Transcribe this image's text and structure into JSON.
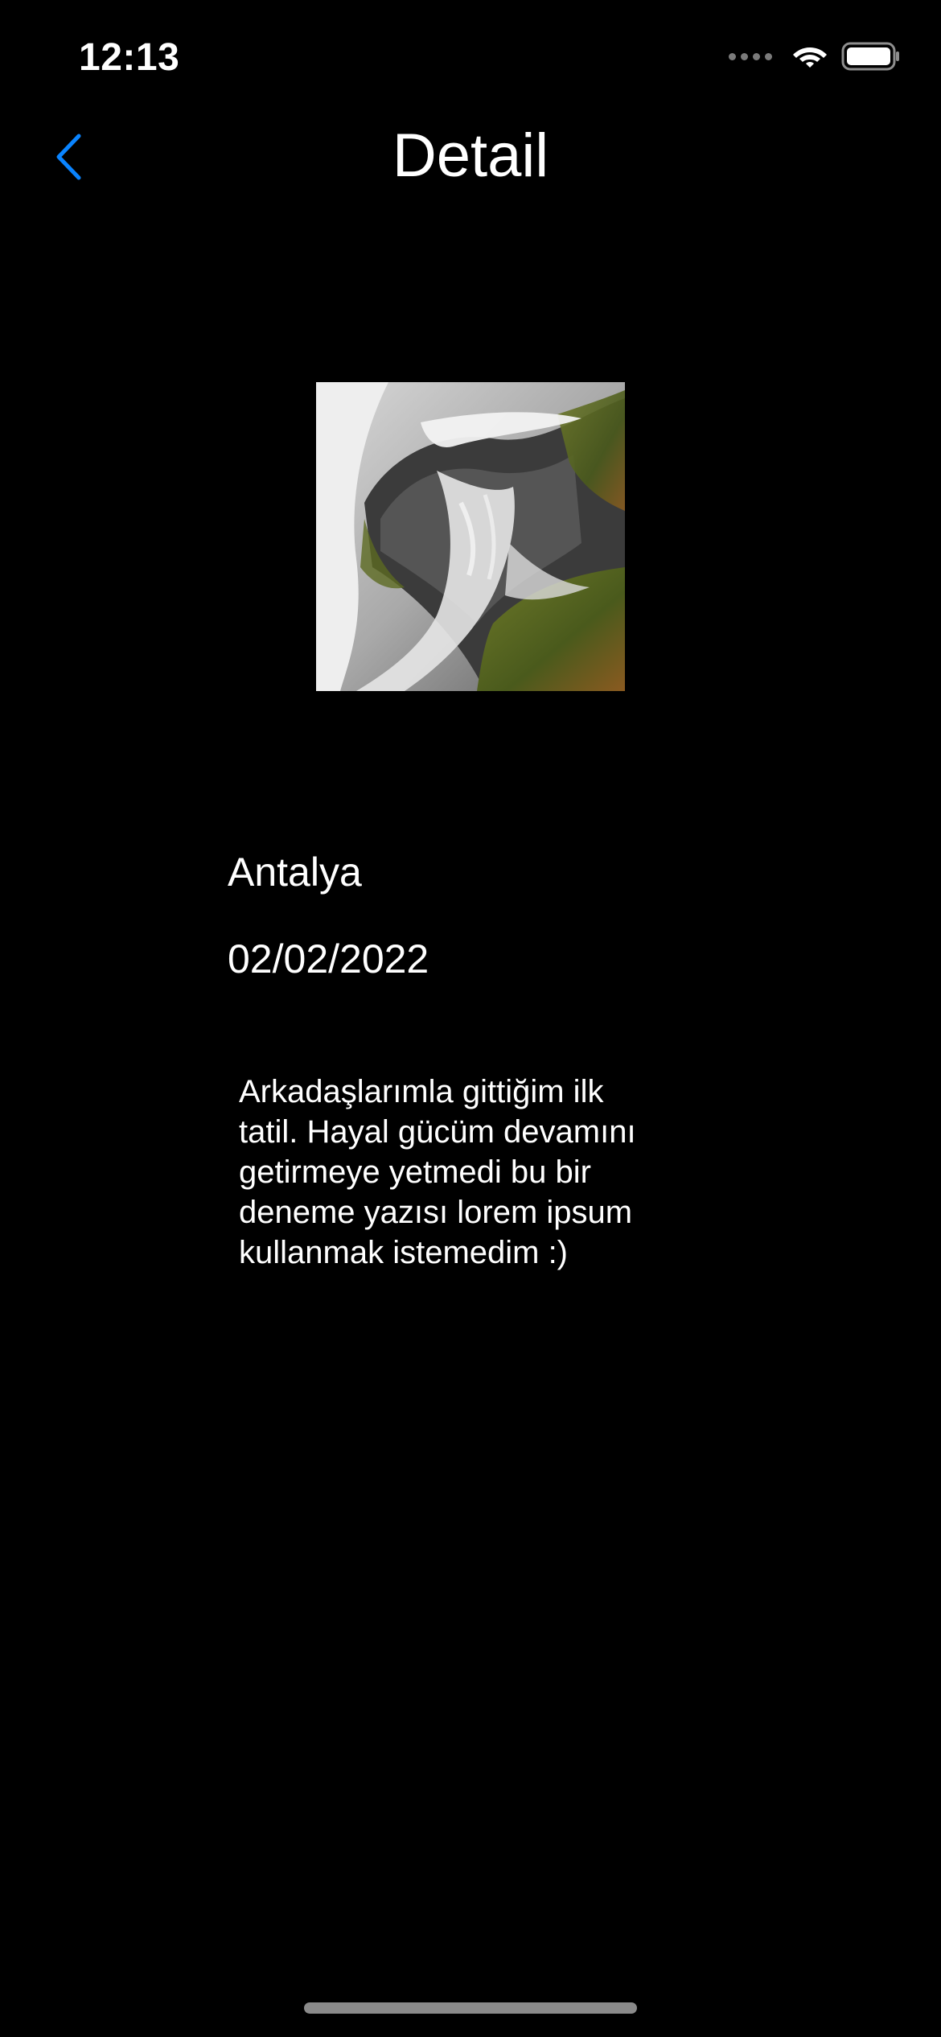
{
  "status_bar": {
    "time": "12:13",
    "signal_icon": "cellular-signal-icon",
    "wifi_icon": "wifi-icon",
    "battery_icon": "battery-icon"
  },
  "nav": {
    "title": "Detail",
    "back_icon": "chevron-left-icon",
    "accent_color": "#0a84ff"
  },
  "detail": {
    "photo_description": "waterfall-rock-photo",
    "place": "Antalya",
    "date": "02/02/2022",
    "description": "Arkadaşlarımla gittiğim ilk\ntatil. Hayal gücüm devamını\ngetirmeye yetmedi bu bir\ndeneme yazısı lorem ipsum\nkullanmak istemedim :)"
  },
  "colors": {
    "background": "#000000",
    "text": "#ffffff"
  }
}
